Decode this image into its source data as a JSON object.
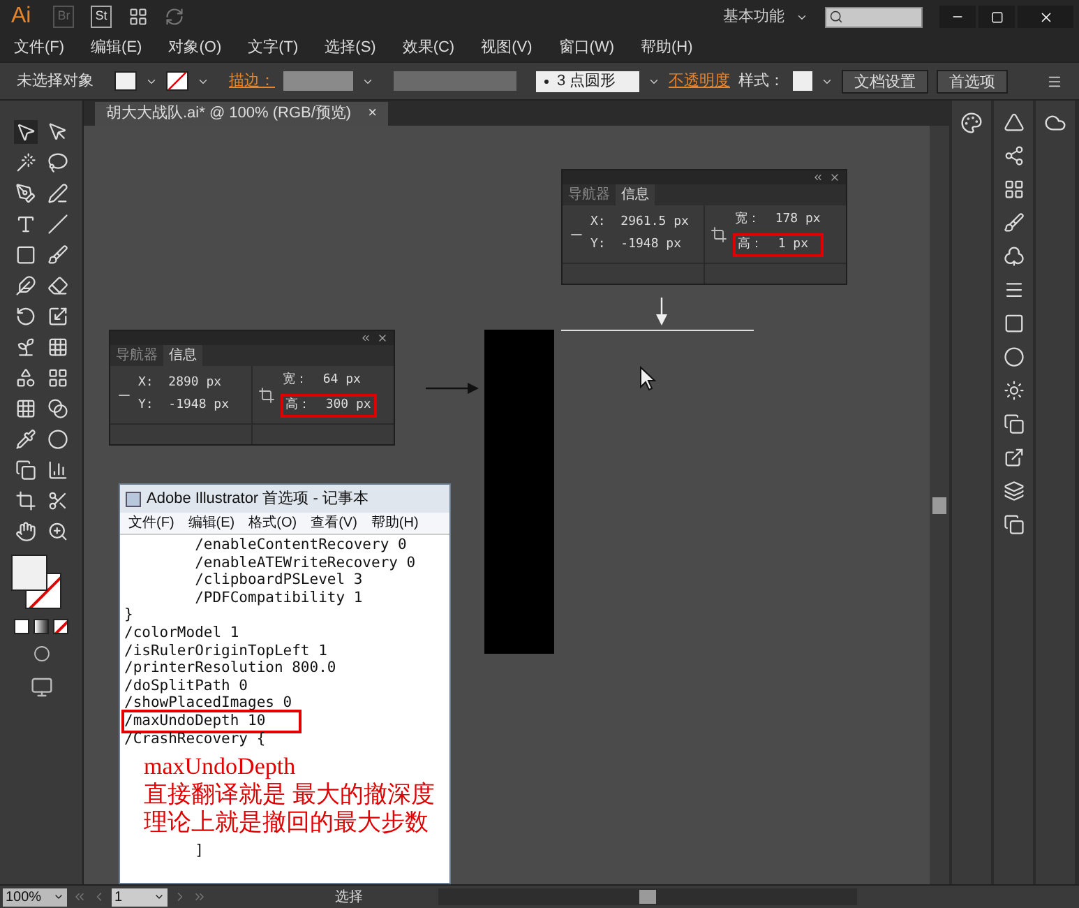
{
  "title_bar": {
    "logo": "Ai",
    "bridge": "Br",
    "stock": "St",
    "workspace": "基本功能"
  },
  "menu": [
    "文件(F)",
    "编辑(E)",
    "对象(O)",
    "文字(T)",
    "选择(S)",
    "效果(C)",
    "视图(V)",
    "窗口(W)",
    "帮助(H)"
  ],
  "control_bar": {
    "selection": "未选择对象",
    "stroke_label": "描边：",
    "brush": "3 点圆形",
    "opacity_label": "不透明度",
    "style_label": "样式：",
    "buttons": [
      "文档设置",
      "首选项"
    ]
  },
  "document_tab": {
    "title": "胡大大战队.ai* @ 100% (RGB/预览)",
    "close": "×"
  },
  "info_panels": [
    {
      "tabs": [
        {
          "label": "导航器",
          "selected": false
        },
        {
          "label": "信息",
          "selected": true
        }
      ],
      "x": "X:  2890 px",
      "y": "Y:  -1948 px",
      "width": "宽：  64 px",
      "height": "高：  300 px",
      "height_highlighted": true
    },
    {
      "tabs": [
        {
          "label": "导航器",
          "selected": false
        },
        {
          "label": "信息",
          "selected": true
        }
      ],
      "x": "X:  2961.5 px",
      "y": "Y:  -1948 px",
      "width": "宽：  178 px",
      "height": "高：  1 px",
      "height_highlighted": true
    }
  ],
  "notepad": {
    "title": "Adobe Illustrator 首选项 - 记事本",
    "menu": [
      "文件(F)",
      "编辑(E)",
      "格式(O)",
      "查看(V)",
      "帮助(H)"
    ],
    "lines": [
      {
        "text": "        /enableContentRecovery 0",
        "highlighted": false
      },
      {
        "text": "        /enableATEWriteRecovery 0",
        "highlighted": false
      },
      {
        "text": "        /clipboardPSLevel 3",
        "highlighted": false
      },
      {
        "text": "        /PDFCompatibility 1",
        "highlighted": false
      },
      {
        "text": "}",
        "highlighted": false
      },
      {
        "text": "/colorModel 1",
        "highlighted": false
      },
      {
        "text": "/isRulerOriginTopLeft 1",
        "highlighted": false
      },
      {
        "text": "/printerResolution 800.0",
        "highlighted": false
      },
      {
        "text": "/doSplitPath 0",
        "highlighted": false
      },
      {
        "text": "/showPlacedImages 0",
        "highlighted": false
      },
      {
        "text": "/maxUndoDepth 10",
        "highlighted": true
      },
      {
        "text": "/CrashRecovery {",
        "highlighted": false
      }
    ],
    "tail_lines": [
      "        ]"
    ]
  },
  "annotation": {
    "title": "maxUndoDepth",
    "lines": [
      "直接翻译就是 最大的撤深度",
      "理论上就是撤回的最大步数"
    ]
  },
  "status_bar": {
    "zoom": "100%",
    "page": "1",
    "tool": "选择"
  }
}
